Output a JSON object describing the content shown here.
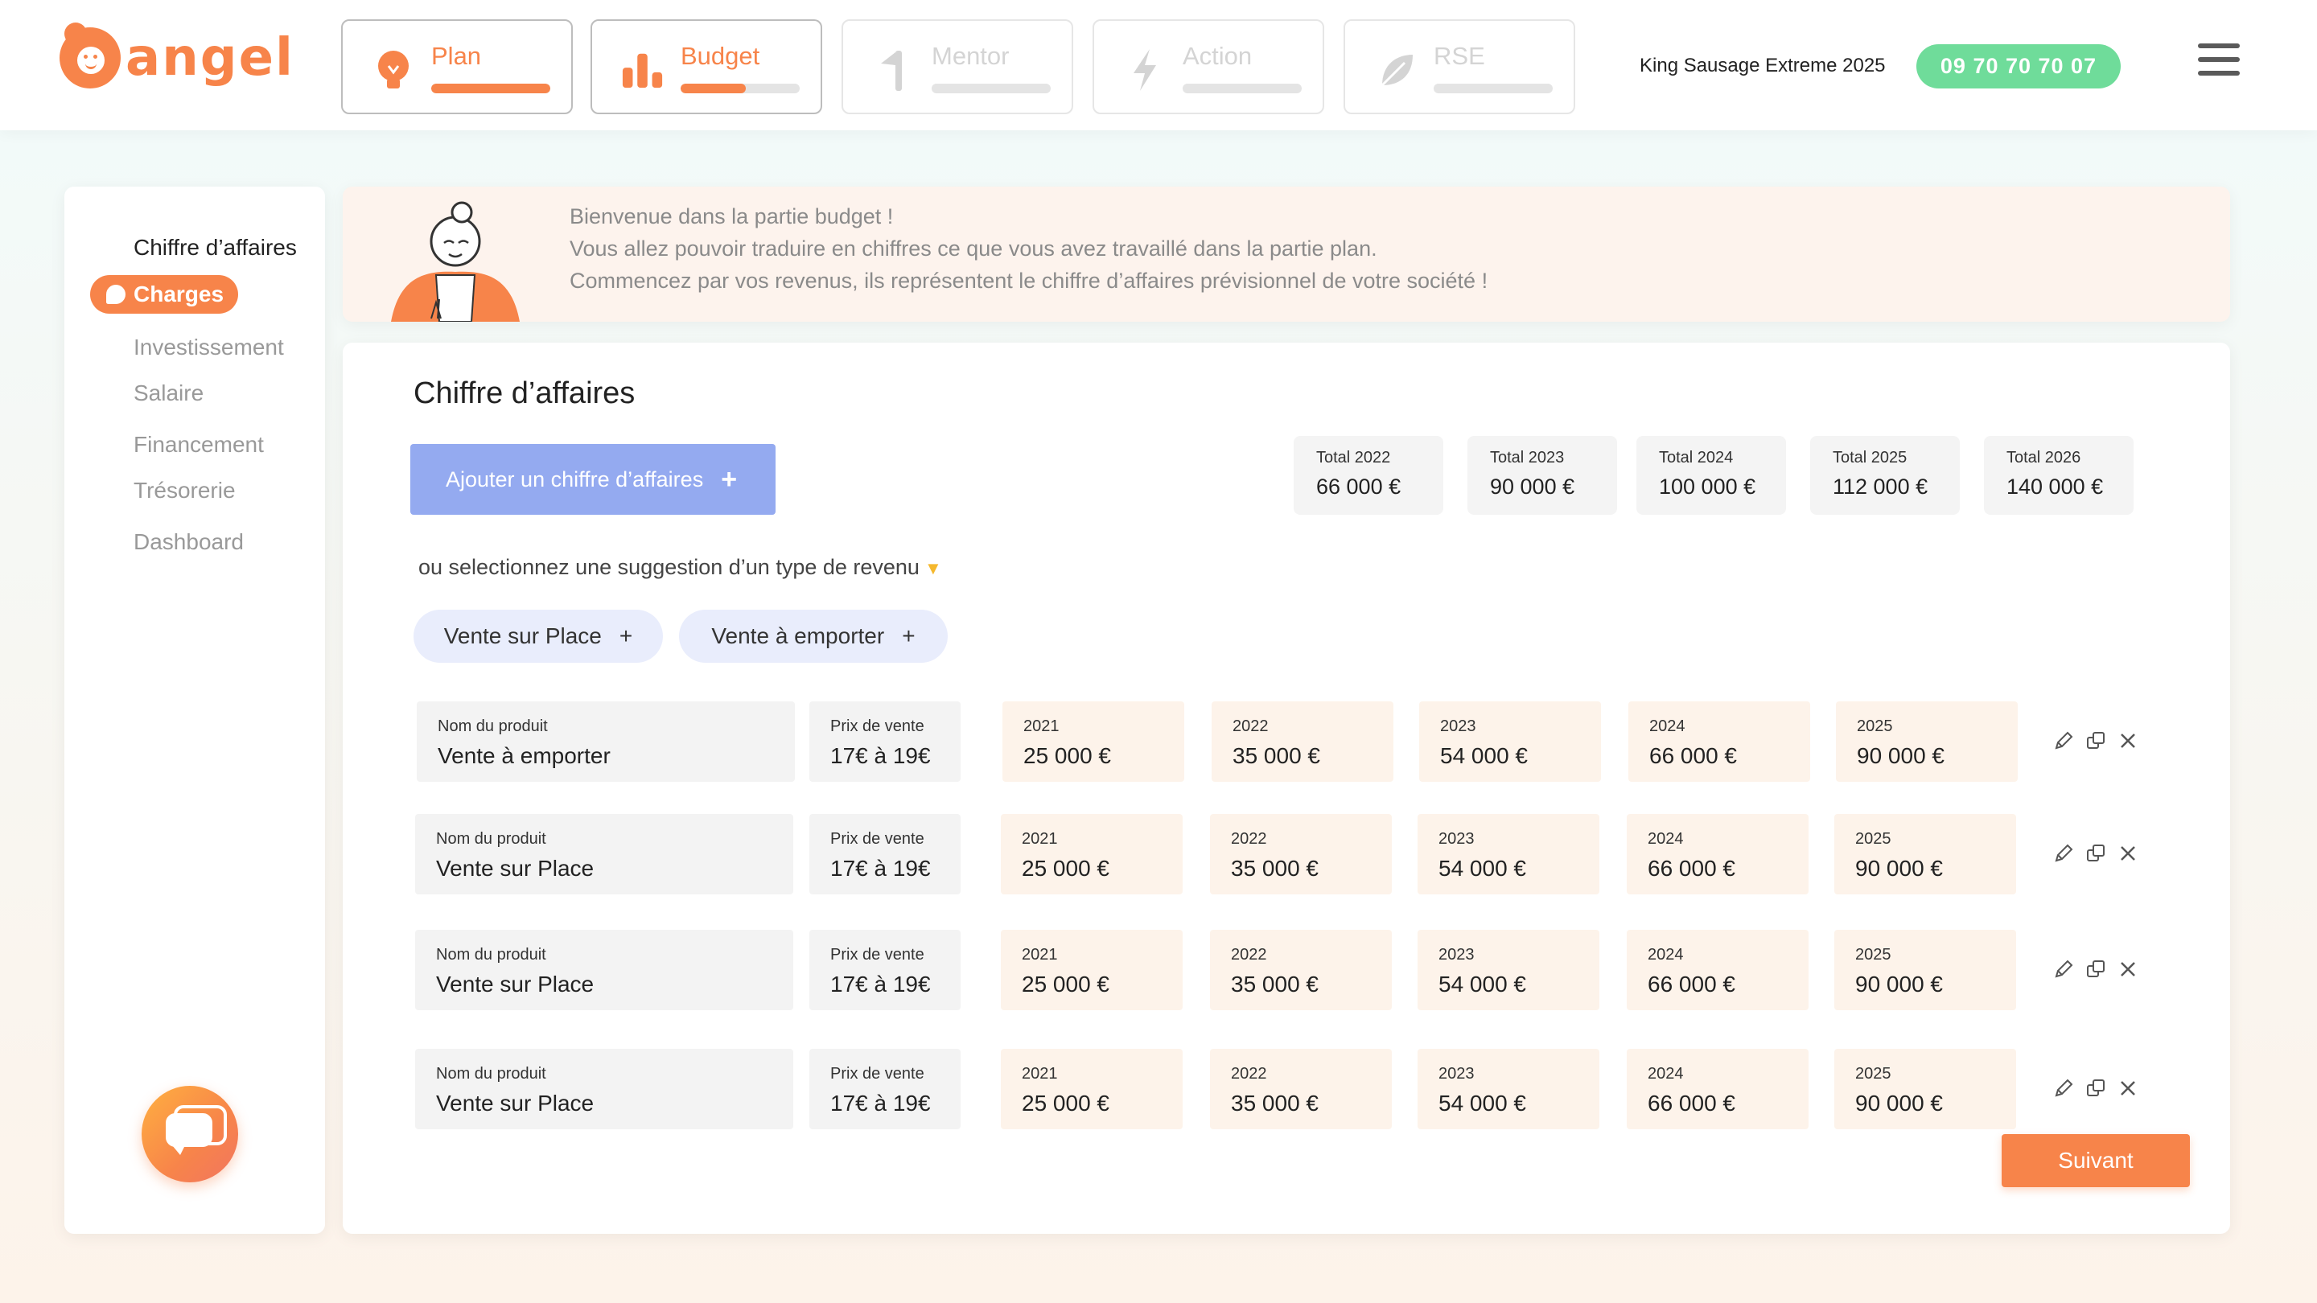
{
  "header": {
    "logo_text": "angel",
    "tabs": [
      {
        "label": "Plan",
        "icon": "lightbulb-icon",
        "state": "active",
        "progress": 1.0
      },
      {
        "label": "Budget",
        "icon": "bar-chart-icon",
        "state": "active",
        "progress": 0.55
      },
      {
        "label": "Mentor",
        "icon": "flag-icon",
        "state": "disabled",
        "progress": 0
      },
      {
        "label": "Action",
        "icon": "lightning-icon",
        "state": "disabled",
        "progress": 0
      },
      {
        "label": "RSE",
        "icon": "leaf-icon",
        "state": "disabled",
        "progress": 0
      }
    ],
    "company": "King Sausage Extreme 2025",
    "phone": "09 70 70 70 07"
  },
  "sidebar": {
    "items": [
      {
        "label": "Chiffre d’affaires",
        "state": "current"
      },
      {
        "label": "Charges",
        "state": "selected"
      },
      {
        "label": "Investissement",
        "state": "inactive"
      },
      {
        "label": "Salaire",
        "state": "inactive"
      },
      {
        "label": "Financement",
        "state": "inactive"
      },
      {
        "label": "Trésorerie",
        "state": "inactive"
      },
      {
        "label": "Dashboard",
        "state": "inactive"
      }
    ]
  },
  "banner": {
    "lines": [
      "Bienvenue dans la partie budget !",
      "Vous allez pouvoir traduire en chiffres ce que vous avez travaillé dans la partie plan.",
      "Commencez par vos revenus, ils représentent le chiffre d’affaires prévisionnel de votre société !"
    ]
  },
  "main": {
    "title": "Chiffre d’affaires",
    "add_button": "Ajouter un chiffre d’affaires",
    "totals": [
      {
        "label": "Total 2022",
        "value": "66 000 €"
      },
      {
        "label": "Total 2023",
        "value": "90 000 €"
      },
      {
        "label": "Total 2024",
        "value": "100 000 €"
      },
      {
        "label": "Total 2025",
        "value": "112 000 €"
      },
      {
        "label": "Total 2026",
        "value": "140 000 €"
      }
    ],
    "suggest_text": "ou selectionnez une suggestion d’un type de revenu",
    "suggestions": [
      "Vente sur Place",
      "Vente à emporter"
    ],
    "rows": [
      {
        "name_label": "Nom du produit",
        "name": "Vente à emporter",
        "price_label": "Prix de vente",
        "price": "17€ à 19€",
        "years": [
          {
            "year": "2021",
            "value": "25 000 €"
          },
          {
            "year": "2022",
            "value": "35 000 €"
          },
          {
            "year": "2023",
            "value": "54 000 €"
          },
          {
            "year": "2024",
            "value": "66 000 €"
          },
          {
            "year": "2025",
            "value": "90 000 €"
          }
        ]
      },
      {
        "name_label": "Nom du produit",
        "name": "Vente sur Place",
        "price_label": "Prix de vente",
        "price": "17€ à 19€",
        "years": [
          {
            "year": "2021",
            "value": "25 000 €"
          },
          {
            "year": "2022",
            "value": "35 000 €"
          },
          {
            "year": "2023",
            "value": "54 000 €"
          },
          {
            "year": "2024",
            "value": "66 000 €"
          },
          {
            "year": "2025",
            "value": "90 000 €"
          }
        ]
      },
      {
        "name_label": "Nom du produit",
        "name": "Vente sur Place",
        "price_label": "Prix de vente",
        "price": "17€ à 19€",
        "years": [
          {
            "year": "2021",
            "value": "25 000 €"
          },
          {
            "year": "2022",
            "value": "35 000 €"
          },
          {
            "year": "2023",
            "value": "54 000 €"
          },
          {
            "year": "2024",
            "value": "66 000 €"
          },
          {
            "year": "2025",
            "value": "90 000 €"
          }
        ]
      },
      {
        "name_label": "Nom du produit",
        "name": "Vente sur Place",
        "price_label": "Prix de vente",
        "price": "17€ à 19€",
        "years": [
          {
            "year": "2021",
            "value": "25 000 €"
          },
          {
            "year": "2022",
            "value": "35 000 €"
          },
          {
            "year": "2023",
            "value": "54 000 €"
          },
          {
            "year": "2024",
            "value": "66 000 €"
          },
          {
            "year": "2025",
            "value": "90 000 €"
          }
        ]
      }
    ],
    "row_actions": [
      "edit-icon",
      "duplicate-icon",
      "delete-icon"
    ],
    "next_button": "Suivant"
  },
  "colors": {
    "accent": "#f7844a",
    "phone_bg": "#6fdc9a",
    "add_button_bg": "#94aaf0",
    "chip_bg": "#e9edfc",
    "year_field_bg": "#fdf3ea",
    "banner_bg": "#fdf3ed"
  }
}
